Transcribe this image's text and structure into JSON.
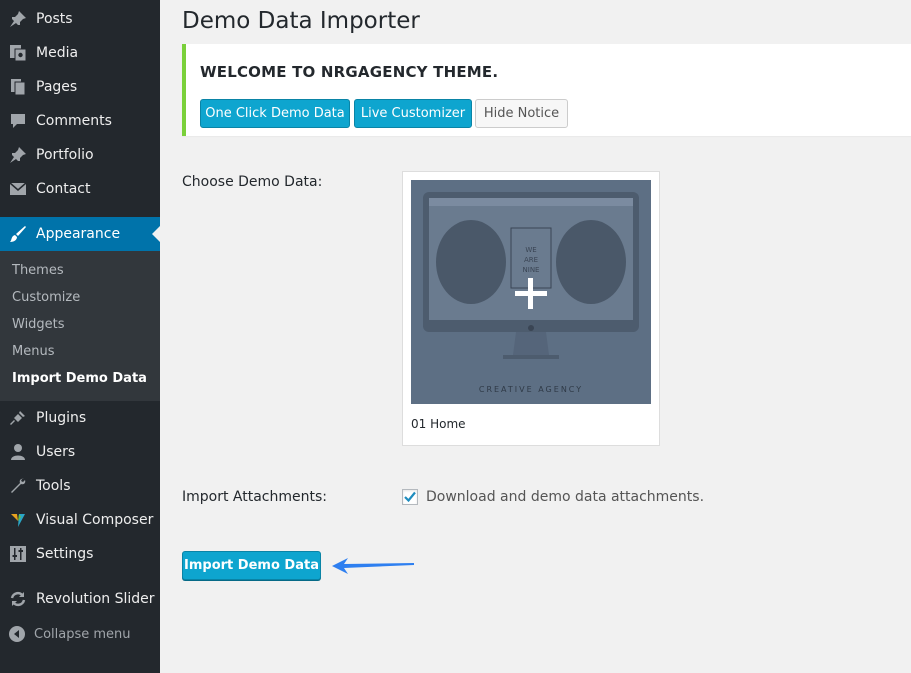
{
  "sidebar": {
    "items": [
      {
        "label": "Posts",
        "icon": "pin-icon"
      },
      {
        "label": "Media",
        "icon": "media-icon"
      },
      {
        "label": "Pages",
        "icon": "pages-icon"
      },
      {
        "label": "Comments",
        "icon": "comment-icon"
      },
      {
        "label": "Portfolio",
        "icon": "pin-icon"
      },
      {
        "label": "Contact",
        "icon": "envelope-icon"
      },
      {
        "label": "Appearance",
        "icon": "brush-icon",
        "active": true
      },
      {
        "label": "Plugins",
        "icon": "plug-icon"
      },
      {
        "label": "Users",
        "icon": "user-icon"
      },
      {
        "label": "Tools",
        "icon": "wrench-icon"
      },
      {
        "label": "Visual Composer",
        "icon": "visual-composer-icon"
      },
      {
        "label": "Settings",
        "icon": "settings-icon"
      },
      {
        "label": "Revolution Slider",
        "icon": "refresh-icon"
      }
    ],
    "submenu": [
      "Themes",
      "Customize",
      "Widgets",
      "Menus",
      "Import Demo Data"
    ],
    "collapse_label": "Collapse menu"
  },
  "page": {
    "title": "Demo Data Importer"
  },
  "notice": {
    "title": "WELCOME TO NRGAGENCY THEME.",
    "buttons": [
      "One Click Demo Data",
      "Live Customizer",
      "Hide Notice"
    ]
  },
  "choose": {
    "label": "Choose Demo Data:",
    "demo": {
      "caption": "01 Home",
      "thumb_text_lines": [
        "WE",
        "ARE",
        "NINE"
      ],
      "thumb_footer": "CREATIVE AGENCY"
    }
  },
  "attachments": {
    "label": "Import Attachments:",
    "checkbox_label": "Download and demo data attachments.",
    "checked": true
  },
  "import_button": "Import Demo Data",
  "colors": {
    "sidebar_bg": "#23282d",
    "active_bg": "#0073aa",
    "primary_button": "#0ea5cf",
    "notice_border": "#7ad03a",
    "arrow": "#2e7ff0"
  }
}
